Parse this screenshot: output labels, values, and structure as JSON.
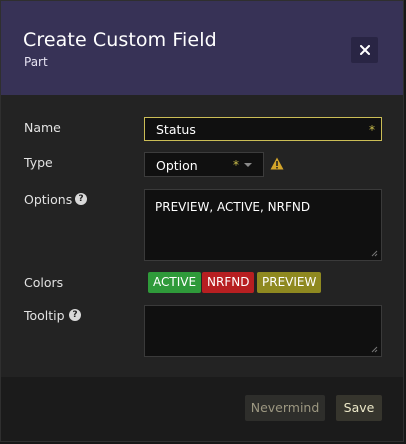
{
  "dialog": {
    "title": "Create Custom Field",
    "subtitle": "Part",
    "close_icon": "close-icon"
  },
  "form": {
    "name": {
      "label": "Name",
      "value": "Status",
      "required_mark": "*"
    },
    "type": {
      "label": "Type",
      "value": "Option",
      "required_mark": "*",
      "warning_icon": "warning-icon"
    },
    "options": {
      "label": "Options",
      "value": "PREVIEW, ACTIVE, NRFND",
      "help_icon": "help-icon"
    },
    "colors": {
      "label": "Colors",
      "badges": [
        {
          "label": "ACTIVE",
          "color": "#2f9a3a"
        },
        {
          "label": "NRFND",
          "color": "#b71f21"
        },
        {
          "label": "PREVIEW",
          "color": "#8f8920"
        }
      ]
    },
    "tooltip": {
      "label": "Tooltip",
      "value": "",
      "help_icon": "help-icon"
    }
  },
  "footer": {
    "nevermind_label": "Nevermind",
    "save_label": "Save"
  },
  "colors": {
    "header": "#373256",
    "input_focus": "#cbbd56",
    "warning": "#d4a52a"
  }
}
